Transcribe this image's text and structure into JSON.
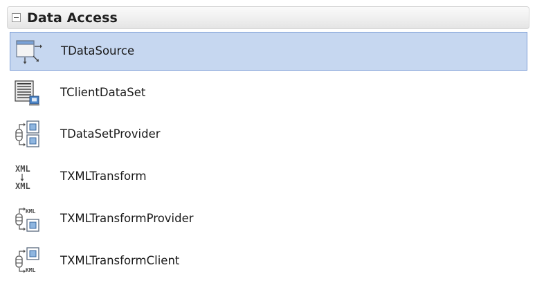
{
  "category": {
    "title": "Data Access"
  },
  "items": [
    {
      "label": "TDataSource",
      "icon": "datasource-icon",
      "selected": true
    },
    {
      "label": "TClientDataSet",
      "icon": "client-dataset-icon",
      "selected": false
    },
    {
      "label": "TDataSetProvider",
      "icon": "dataset-provider-icon",
      "selected": false
    },
    {
      "label": "TXMLTransform",
      "icon": "xml-transform-icon",
      "selected": false
    },
    {
      "label": "TXMLTransformProvider",
      "icon": "xml-transform-provider-icon",
      "selected": false
    },
    {
      "label": "TXMLTransformClient",
      "icon": "xml-transform-client-icon",
      "selected": false
    }
  ],
  "icon_text": {
    "xml": "XML",
    "kml": "KML"
  },
  "colors": {
    "selection_fill": "#c6d7f0",
    "selection_border": "#7c9dd6"
  }
}
